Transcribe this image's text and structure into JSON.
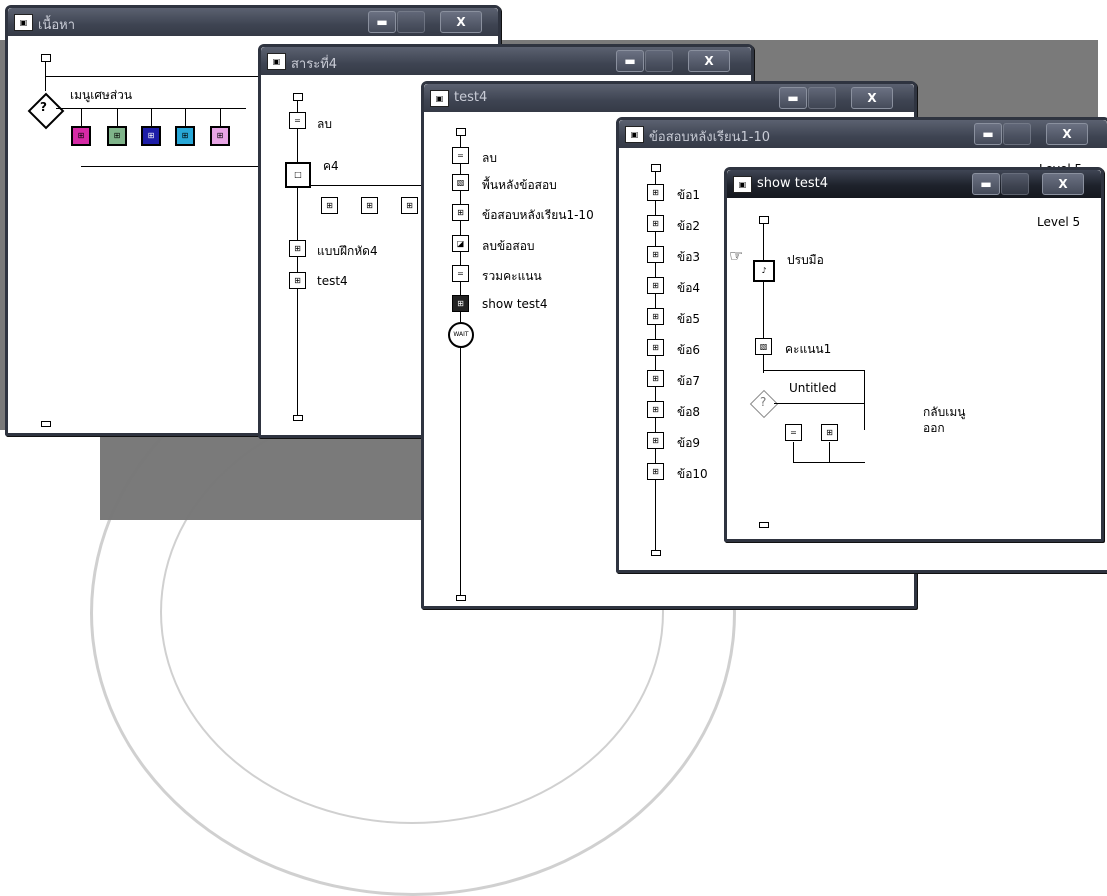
{
  "desktop": {
    "background": "#7a7a7a"
  },
  "windows": [
    {
      "title": "เนื้อหา",
      "flow": {
        "decision_label": "เมนูเศษส่วน",
        "branch_colors": [
          "#d62aa6",
          "#7fb48a",
          "#1d1da8",
          "#28a8d8",
          "#e7a4e4"
        ]
      }
    },
    {
      "title": "สาระที่4",
      "flow": {
        "items": [
          "ลบ",
          "ค4",
          "แบบฝึกหัด4",
          "test4"
        ]
      }
    },
    {
      "title": "test4",
      "flow": {
        "items": [
          "ลบ",
          "พื้นหลังข้อสอบ",
          "ข้อสอบหลังเรียน1-10",
          "ลบข้อสอบ",
          "รวมคะแนน",
          "show test4"
        ],
        "wait_label": "WAIT"
      }
    },
    {
      "title": "ข้อสอบหลังเรียน1-10",
      "level": "Level 5",
      "flow": {
        "items": [
          "ข้อ1",
          "ข้อ2",
          "ข้อ3",
          "ข้อ4",
          "ข้อ5",
          "ข้อ6",
          "ข้อ7",
          "ข้อ8",
          "ข้อ9",
          "ข้อ10"
        ]
      }
    },
    {
      "title": "show test4",
      "level": "Level 5",
      "flow": {
        "items": [
          "ปรบมือ",
          "คะแนน1",
          "Untitled"
        ],
        "side_label_1": "กลับเมนู",
        "side_label_2": "ออก"
      }
    }
  ],
  "controls": {
    "minimize": "▬",
    "close": "X"
  }
}
